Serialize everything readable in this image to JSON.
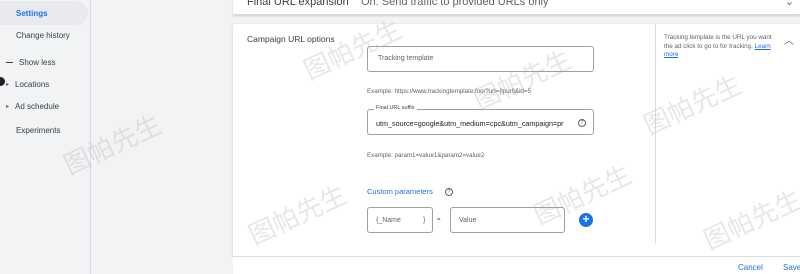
{
  "sidebar": {
    "items": [
      {
        "label": "Settings",
        "active": true
      },
      {
        "label": "Change history"
      },
      {
        "label": "Show less"
      },
      {
        "label": "Locations"
      },
      {
        "label": "Ad schedule"
      },
      {
        "label": "Experiments"
      }
    ]
  },
  "top_section": {
    "label": "Final URL expansion",
    "value": "On: Send traffic to provided URLs only"
  },
  "card": {
    "title": "Campaign URL options",
    "tracking_placeholder": "Tracking template",
    "tracking_example": "Example: https://www.trackingtemplate.foo/?url={lpurl}&id=5",
    "suffix_legend": "Final URL suffix",
    "suffix_value": "utm_source=google&utm_medium=cpc&utm_campaign=pr",
    "suffix_example": "Example: param1=value1&param2=value2",
    "custom_params_title": "Custom parameters",
    "param_name_placeholder": "{_Name",
    "param_name_close": "}",
    "equals": "=",
    "param_value_placeholder": "Value",
    "help_text": "Tracking template is the URL you want the ad click to go to for tracking.",
    "help_link": "Learn more"
  },
  "footer": {
    "cancel_label": "Cancel",
    "save_label": "Save"
  },
  "watermark": "图帕先生",
  "icons": {
    "collapse": "chevron-up-icon",
    "expand": "chevron-down-icon",
    "help": "question-circle-icon",
    "add": "plus-circle-icon"
  },
  "colors": {
    "accent": "#1a73e8",
    "background": "#f1f3f4",
    "card": "#ffffff"
  }
}
